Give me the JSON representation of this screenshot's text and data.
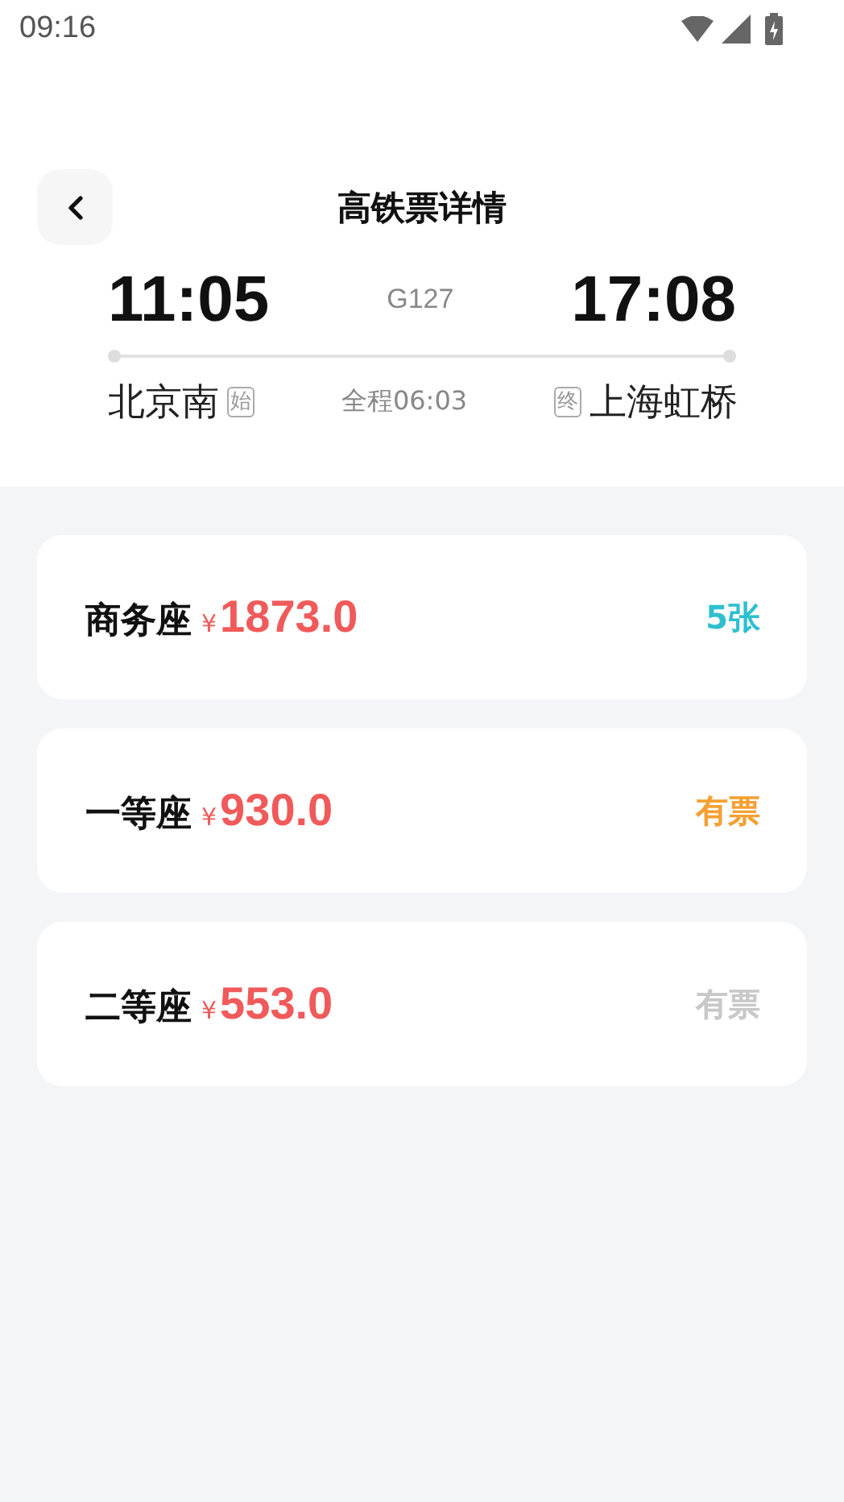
{
  "status_bar": {
    "time": "09:16"
  },
  "header": {
    "title": "高铁票详情"
  },
  "trip": {
    "depart_time": "11:05",
    "train_number": "G127",
    "arrive_time": "17:08",
    "from_station": "北京南",
    "from_tag": "始",
    "duration": "全程06:03",
    "to_tag": "终",
    "to_station": "上海虹桥"
  },
  "seats": [
    {
      "name": "商务座",
      "currency": "¥",
      "price": "1873.0",
      "availability": "5张",
      "color": "#2ebfcf"
    },
    {
      "name": "一等座",
      "currency": "¥",
      "price": "930.0",
      "availability": "有票",
      "color": "#f5a033"
    },
    {
      "name": "二等座",
      "currency": "¥",
      "price": "553.0",
      "availability": "有票",
      "color": "#c8c8c8"
    }
  ]
}
